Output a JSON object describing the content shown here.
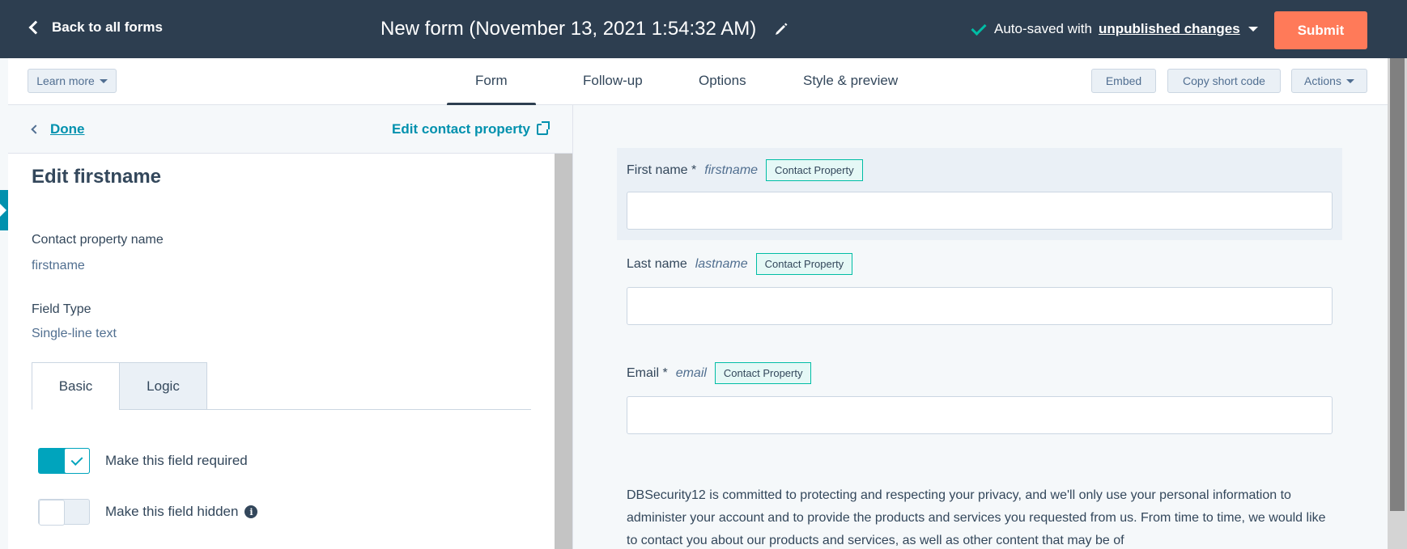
{
  "topbar": {
    "back_label": "Back to all forms",
    "title": "New form (November 13, 2021 1:54:32 AM)",
    "autosave_prefix": "Auto-saved with",
    "autosave_link": "unpublished changes",
    "submit_label": "Submit"
  },
  "nav": {
    "learn_more": "Learn more",
    "tabs": [
      "Form",
      "Follow-up",
      "Options",
      "Style & preview"
    ],
    "embed": "Embed",
    "copy_short_code": "Copy short code",
    "actions": "Actions"
  },
  "editor": {
    "done_label": "Done",
    "edit_property_label": "Edit contact property",
    "title": "Edit firstname",
    "property_name_label": "Contact property name",
    "property_name_value": "firstname",
    "field_type_label": "Field Type",
    "field_type_value": "Single-line text",
    "subtabs": [
      "Basic",
      "Logic"
    ],
    "required_label": "Make this field required",
    "required_on": true,
    "hidden_label": "Make this field hidden",
    "hidden_on": false
  },
  "preview": {
    "badge": "Contact Property",
    "fields": [
      {
        "label": "First name *",
        "internal": "firstname"
      },
      {
        "label": "Last name",
        "internal": "lastname"
      },
      {
        "label": "Email *",
        "internal": "email"
      }
    ],
    "privacy_text": "DBSecurity12 is committed to protecting and respecting your privacy, and we'll only use your personal information to administer your account and to provide the products and services you requested from us. From time to time, we would like to contact you about our products and services, as well as other content that may be of"
  }
}
